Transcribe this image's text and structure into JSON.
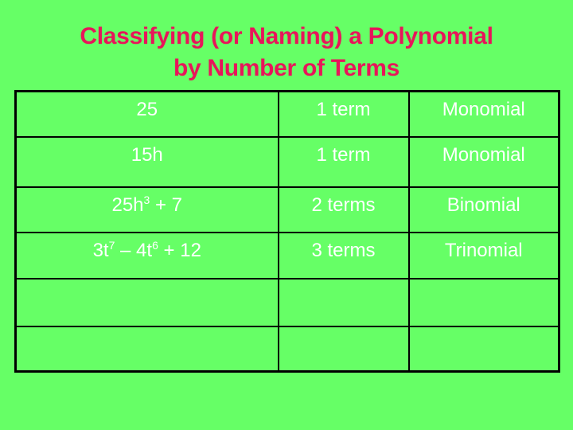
{
  "title": {
    "line1": "Classifying (or Naming) a Polynomial",
    "line2": "by Number of Terms"
  },
  "table": {
    "rows": [
      {
        "expression": [
          {
            "t": "25"
          }
        ],
        "terms": "1 term",
        "name": "Monomial"
      },
      {
        "expression": [
          {
            "t": "15h"
          }
        ],
        "terms": "1 term",
        "name": "Monomial"
      },
      {
        "expression": [
          {
            "t": "25h"
          },
          {
            "sup": "3"
          },
          {
            "t": " + 7"
          }
        ],
        "terms": "2 terms",
        "name": "Binomial"
      },
      {
        "expression": [
          {
            "t": "3t"
          },
          {
            "sup": "7"
          },
          {
            "t": " – 4t"
          },
          {
            "sup": "6"
          },
          {
            "t": " + 12"
          }
        ],
        "terms": "3 terms",
        "name": "Trinomial"
      },
      {
        "expression": [],
        "terms": "",
        "name": ""
      },
      {
        "expression": [],
        "terms": "",
        "name": ""
      }
    ]
  },
  "colors": {
    "background": "#66ff66",
    "title": "#e8155a",
    "cell_text": "#ffffff",
    "border": "#000000"
  }
}
